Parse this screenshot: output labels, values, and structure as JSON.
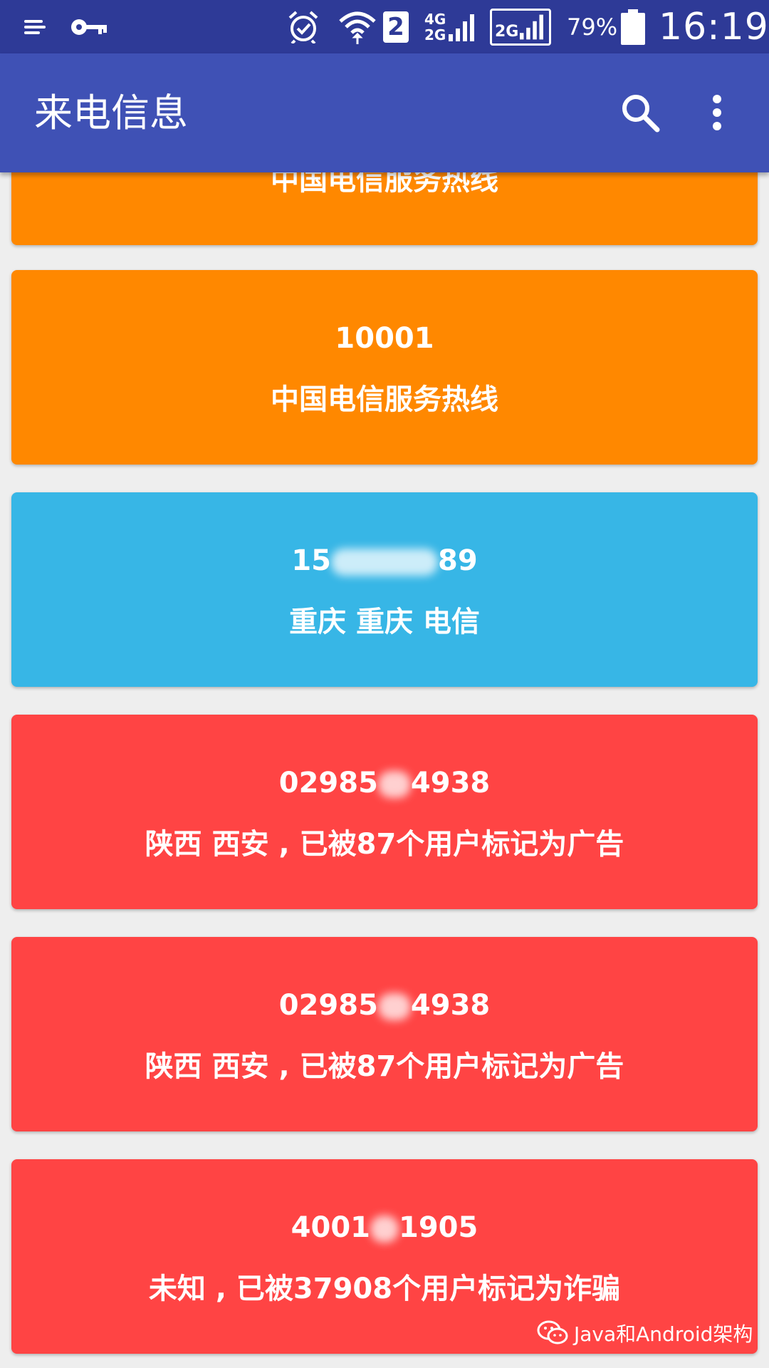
{
  "status_bar": {
    "battery_pct": "79%",
    "time": "16:19",
    "sim_slot": "2",
    "net1_top": "4G",
    "net1_bottom": "2G",
    "net2": "2G"
  },
  "app_bar": {
    "title": "来电信息"
  },
  "cards": [
    {
      "number": "",
      "desc": "中国电信服务热线",
      "color": "#ff8800"
    },
    {
      "number": "10001",
      "desc": "中国电信服务热线",
      "color": "#ff8800"
    },
    {
      "number_prefix": "15",
      "number_suffix": "89",
      "desc": "重庆 重庆 电信",
      "color": "#37b6e6"
    },
    {
      "number_prefix": "02985",
      "number_suffix": "4938",
      "desc": "陕西 西安 , 已被87个用户标记为广告",
      "color": "#ff4444"
    },
    {
      "number_prefix": "02985",
      "number_suffix": "4938",
      "desc": "陕西 西安 , 已被87个用户标记为广告",
      "color": "#ff4444"
    },
    {
      "number_prefix": "4001",
      "number_suffix": "1905",
      "desc": "未知 , 已被37908个用户标记为诈骗",
      "color": "#ff4444"
    }
  ],
  "watermark": {
    "text": "Java和Android架构",
    "icon": "wechat-icon"
  },
  "icons": {
    "status_menu": "notification-menu-icon",
    "status_key": "key-icon",
    "alarm": "alarm-icon",
    "wifi": "wifi-icon",
    "search": "search-icon",
    "more": "more-vert-icon"
  }
}
